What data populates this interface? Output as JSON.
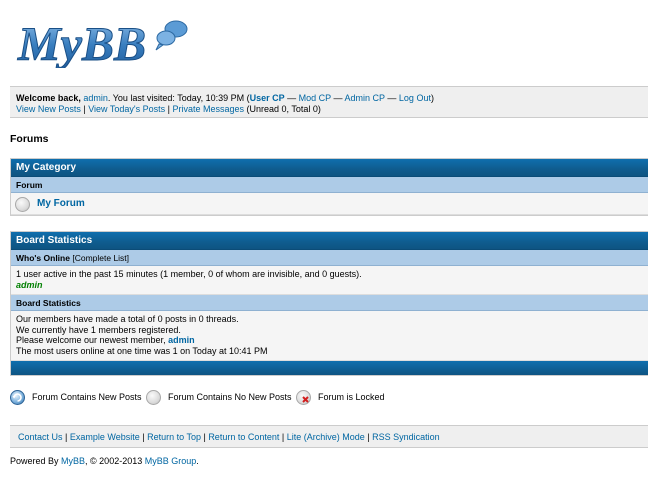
{
  "logo": {
    "text": "MyBB"
  },
  "welcome": {
    "greeting": "Welcome back, ",
    "username": "admin",
    "visit_text": ". You last visited: Today, 10:39 PM (",
    "user_cp": "User CP",
    "dash1": " — ",
    "mod_cp": "Mod CP",
    "dash2": " — ",
    "admin_cp": "Admin CP",
    "dash3": " — ",
    "logout": "Log Out",
    "close_paren": ")",
    "view_new_posts": "View New Posts",
    "sep1": " | ",
    "view_todays_posts": "View Today's Posts",
    "sep2": " | ",
    "private_messages": "Private Messages",
    "pm_counts": " (Unread 0, Total 0)"
  },
  "page_title": "Forums",
  "category": {
    "title": "My Category",
    "column_header": "Forum",
    "forums": [
      {
        "name": "My Forum"
      }
    ]
  },
  "stats": {
    "title": "Board Statistics",
    "whos_online_label": "Who's Online",
    "complete_list": "[Complete List]",
    "online_summary": "1 user active in the past 15 minutes (1 member, 0 of whom are invisible, and 0 guests).",
    "online_user": "admin",
    "board_stats_label": "Board Statistics",
    "line1": "Our members have made a total of 0 posts in 0 threads.",
    "line2": "We currently have 1 members registered.",
    "line3_prefix": "Please welcome our newest member, ",
    "newest_member": "admin",
    "line4": "The most users online at one time was 1 on Today at 10:41 PM"
  },
  "legend": {
    "new_posts": "Forum Contains New Posts",
    "no_new_posts": "Forum Contains No New Posts",
    "locked": "Forum is Locked"
  },
  "footer_links": {
    "contact": "Contact Us",
    "website": "Example Website",
    "top": "Return to Top",
    "content": "Return to Content",
    "lite": "Lite (Archive) Mode",
    "rss": "RSS Syndication",
    "sep": " | "
  },
  "powered": {
    "prefix": "Powered By ",
    "mybb": "MyBB",
    "middle": ", © 2002-2013 ",
    "group": "MyBB Group",
    "suffix": "."
  },
  "colors": {
    "link": "#0066a2",
    "thead": "#0f5c8e",
    "tcat": "#adcbe7",
    "online_user": "#008000"
  }
}
